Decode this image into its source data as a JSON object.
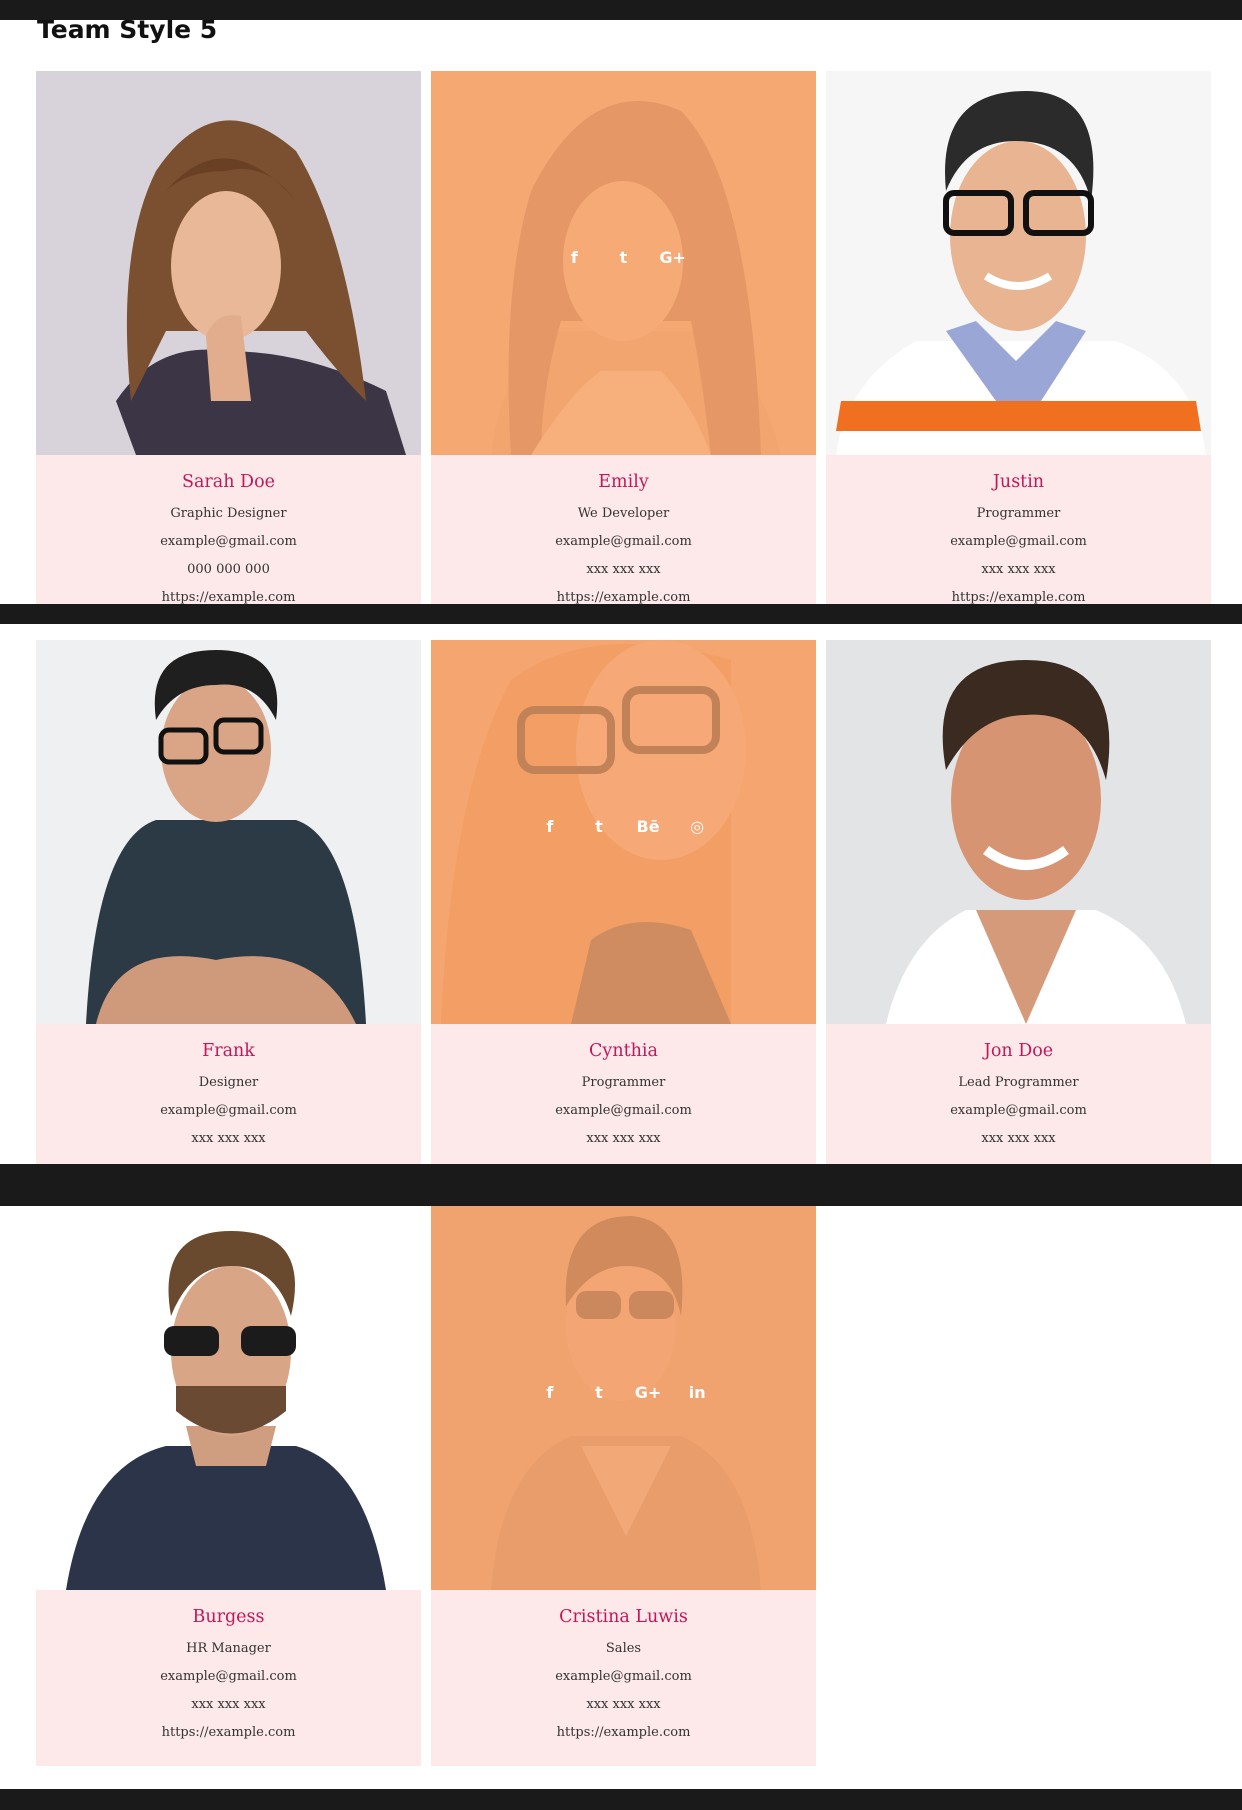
{
  "section": {
    "title": "Team Style 5"
  },
  "members": [
    {
      "name": "Sarah Doe",
      "role": "Graphic Designer",
      "email": "example@gmail.com",
      "phone": "000 000 000",
      "url": "https://example.com",
      "bg": "#d8d2da"
    },
    {
      "name": "Emily",
      "role": "We Developer",
      "email": "example@gmail.com",
      "phone": "xxx xxx xxx",
      "url": "https://example.com",
      "bg": "#f4ad7c",
      "social": [
        "f",
        "t",
        "G+"
      ]
    },
    {
      "name": "Justin",
      "role": "Programmer",
      "email": "example@gmail.com",
      "phone": "xxx xxx xxx",
      "url": "https://example.com",
      "bg": "#f6f6f6"
    },
    {
      "name": "Frank",
      "role": "Designer",
      "email": "example@gmail.com",
      "phone": "xxx xxx xxx",
      "bg": "#eef0f2"
    },
    {
      "name": "Cynthia",
      "role": "Programmer",
      "email": "example@gmail.com",
      "phone": "xxx xxx xxx",
      "bg": "#f0a36b",
      "social": [
        "f",
        "t",
        "Bē",
        "◎"
      ]
    },
    {
      "name": "Jon Doe",
      "role": "Lead Programmer",
      "email": "example@gmail.com",
      "phone": "xxx xxx xxx",
      "bg": "#e3e4e6"
    },
    {
      "name": "Burgess",
      "role": "HR Manager",
      "email": "example@gmail.com",
      "phone": "xxx xxx xxx",
      "url": "https://example.com",
      "bg": "#ffffff"
    },
    {
      "name": "Cristina Luwis",
      "role": "Sales",
      "email": "example@gmail.com",
      "phone": "xxx xxx xxx",
      "url": "https://example.com",
      "bg": "#e09a6c",
      "social": [
        "f",
        "t",
        "G+",
        "in"
      ]
    }
  ],
  "colors": {
    "name": "#c2185b",
    "info_bg": "#fde9e9",
    "overlay": "#f6a670",
    "bar": "#1a1a1a"
  }
}
